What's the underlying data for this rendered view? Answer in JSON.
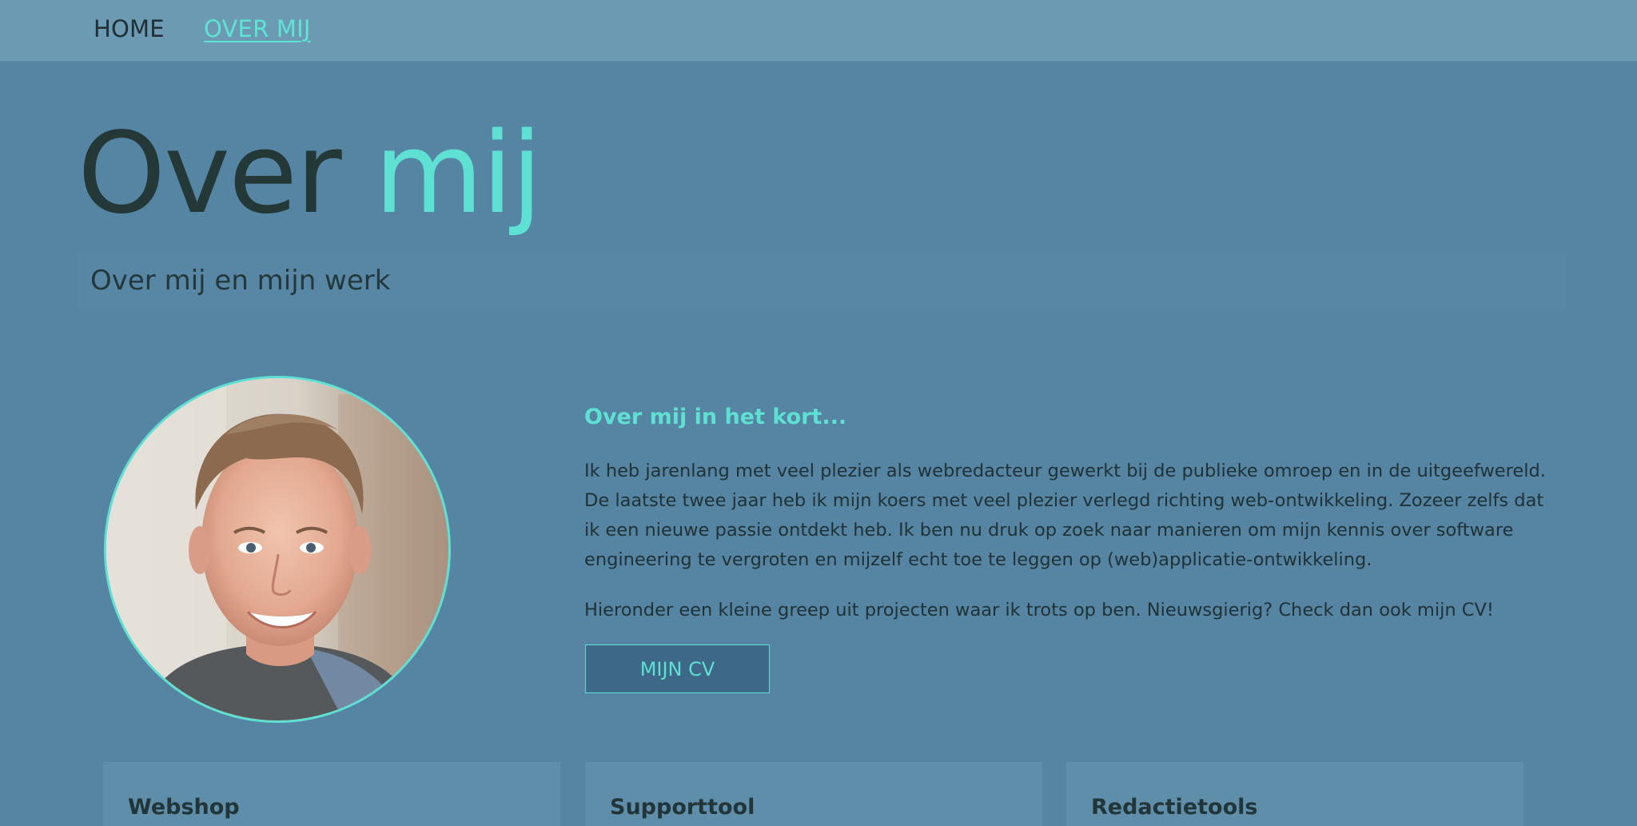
{
  "nav": {
    "home": "HOME",
    "about": "OVER MIJ"
  },
  "hero": {
    "title_part1": "Over ",
    "title_part2": "mij",
    "subtitle": "Over mij en mijn werk"
  },
  "about": {
    "heading": "Over mij in het kort...",
    "paragraph1": "Ik heb jarenlang met veel plezier als webredacteur gewerkt bij de publieke omroep en in de uitgeefwereld. De laatste twee jaar heb ik mijn koers met veel plezier verlegd richting web-ontwikkeling. Zozeer zelfs dat ik een nieuwe passie ontdekt heb. Ik ben nu druk op zoek naar manieren om mijn kennis over software engineering te vergroten en mijzelf echt toe te leggen op (web)applicatie-ontwikkeling.",
    "paragraph2": "Hieronder een kleine greep uit projecten waar ik trots op ben. Nieuwsgierig? Check dan ook mijn CV!",
    "cv_button": "MIJN CV"
  },
  "projects": [
    {
      "title": "Webshop"
    },
    {
      "title": "Supporttool"
    },
    {
      "title": "Redactietools"
    }
  ],
  "colors": {
    "background": "#5585a2",
    "nav_background": "#6b9ab2",
    "accent": "#5ee0d2",
    "text_dark": "#203236",
    "button_background": "#3d6888",
    "card_background": "#5f8eab"
  },
  "icons": {
    "portrait": "profile-photo"
  }
}
